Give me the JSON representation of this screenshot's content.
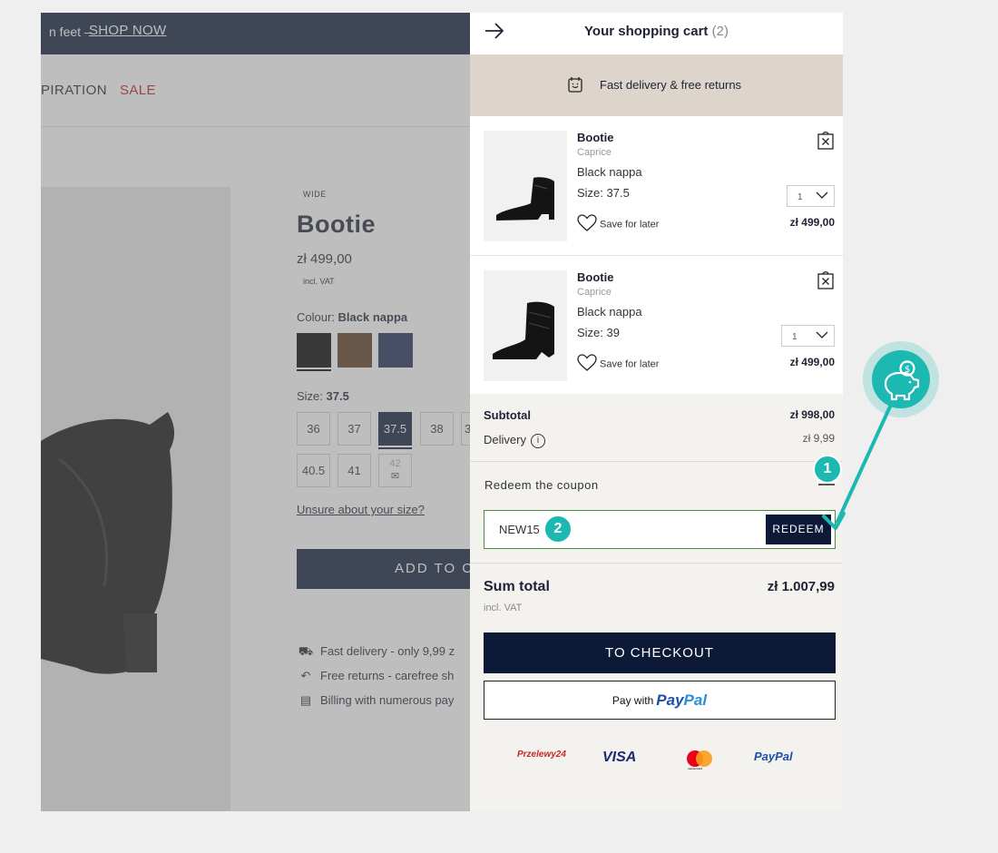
{
  "page": {
    "promo_text": "n feet –",
    "promo_link": "SHOP NOW",
    "nav": [
      "PIRATION",
      "SALE"
    ],
    "product": {
      "badge": "WIDE",
      "title": "Bootie",
      "price": "zł 499,00",
      "vat": "incl. VAT",
      "colour_label": "Colour:",
      "colour_value": "Black nappa",
      "swatches": [
        "#000000",
        "#5b3a20",
        "#1d2a55"
      ],
      "size_label": "Size:",
      "size_value": "37.5",
      "sizes": [
        "36",
        "37",
        "37.5",
        "38",
        "3",
        "40.5",
        "41",
        "42"
      ],
      "selected_size": "37.5",
      "size_help": "Unsure about your size?",
      "add_to_cart": "ADD TO CA",
      "features": [
        "Fast delivery - only 9,99 z",
        "Free returns - carefree sh",
        "Billing with numerous pay"
      ]
    }
  },
  "cart": {
    "title": "Your shopping cart",
    "count": "(2)",
    "banner": "Fast delivery & free returns",
    "items": [
      {
        "name": "Bootie",
        "brand": "Caprice",
        "color": "Black nappa",
        "size": "Size: 37.5",
        "qty": "1",
        "save": "Save for later",
        "price": "zł 499,00"
      },
      {
        "name": "Bootie",
        "brand": "Caprice",
        "color": "Black nappa",
        "size": "Size: 39",
        "qty": "1",
        "save": "Save for later",
        "price": "zł 499,00"
      }
    ],
    "subtotal_label": "Subtotal",
    "subtotal_value": "zł 998,00",
    "delivery_label": "Delivery",
    "delivery_value": "zł 9,99",
    "coupon_label": "Redeem the coupon",
    "coupon_value": "NEW15",
    "redeem_label": "REDEEM",
    "sum_label": "Sum total",
    "sum_vat": "incl. VAT",
    "sum_value": "zł 1.007,99",
    "checkout_label": "TO CHECKOUT",
    "paypal_prefix": "Pay with",
    "paypal_brand_a": "Pay",
    "paypal_brand_b": "Pal",
    "payment_logos": [
      "Przelewy24",
      "VISA",
      "mastercard",
      "PayPal"
    ]
  },
  "annotations": {
    "step1": "1",
    "step2": "2",
    "accent": "#1cb8b2"
  },
  "icons": [
    "arrow-right-icon",
    "calendar-smile-icon",
    "remove-bag-icon",
    "heart-icon",
    "chevron-down-icon",
    "info-icon",
    "piggy-bank-icon",
    "boot-image"
  ]
}
